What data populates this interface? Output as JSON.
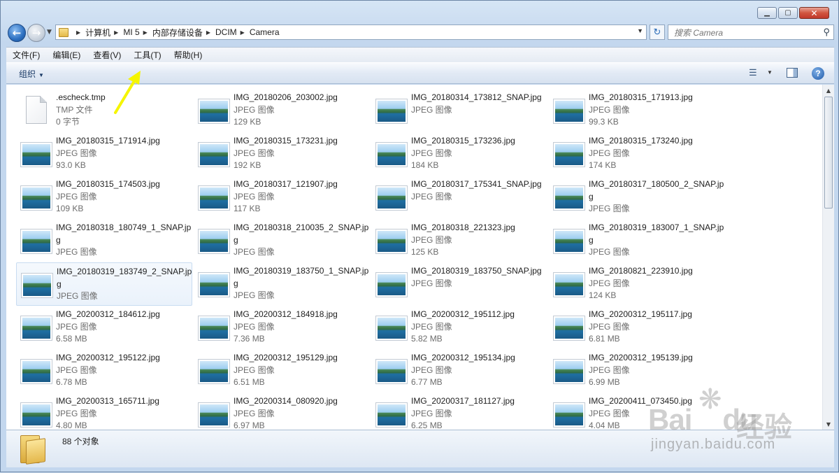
{
  "window": {
    "caption_buttons": {
      "minimize": "▁",
      "maximize": "▢",
      "close": "✕"
    }
  },
  "nav": {
    "breadcrumb": [
      "计算机",
      "MI 5",
      "内部存储设备",
      "DCIM",
      "Camera"
    ],
    "search_placeholder": "搜索 Camera"
  },
  "menu": [
    "文件(F)",
    "编辑(E)",
    "查看(V)",
    "工具(T)",
    "帮助(H)"
  ],
  "toolbar": {
    "organize_label": "组织"
  },
  "files": [
    {
      "name": ".escheck.tmp",
      "type": "TMP 文件",
      "size": "0 字节",
      "kind": "generic"
    },
    {
      "name": "IMG_20180206_203002.jpg",
      "type": "JPEG 图像",
      "size": "129 KB",
      "kind": "image"
    },
    {
      "name": "IMG_20180314_173812_SNAP.jpg",
      "type": "JPEG 图像",
      "size": "",
      "kind": "image"
    },
    {
      "name": "IMG_20180315_171913.jpg",
      "type": "JPEG 图像",
      "size": "99.3 KB",
      "kind": "image"
    },
    {
      "name": "IMG_20180315_171914.jpg",
      "type": "JPEG 图像",
      "size": "93.0 KB",
      "kind": "image"
    },
    {
      "name": "IMG_20180315_173231.jpg",
      "type": "JPEG 图像",
      "size": "192 KB",
      "kind": "image"
    },
    {
      "name": "IMG_20180315_173236.jpg",
      "type": "JPEG 图像",
      "size": "184 KB",
      "kind": "image"
    },
    {
      "name": "IMG_20180315_173240.jpg",
      "type": "JPEG 图像",
      "size": "174 KB",
      "kind": "image"
    },
    {
      "name": "IMG_20180315_174503.jpg",
      "type": "JPEG 图像",
      "size": "109 KB",
      "kind": "image"
    },
    {
      "name": "IMG_20180317_121907.jpg",
      "type": "JPEG 图像",
      "size": "117 KB",
      "kind": "image"
    },
    {
      "name": "IMG_20180317_175341_SNAP.jpg",
      "type": "JPEG 图像",
      "size": "",
      "kind": "image"
    },
    {
      "name": "IMG_20180317_180500_2_SNAP.jpg",
      "type": "JPEG 图像",
      "size": "",
      "kind": "image"
    },
    {
      "name": "IMG_20180318_180749_1_SNAP.jpg",
      "type": "JPEG 图像",
      "size": "",
      "kind": "image"
    },
    {
      "name": "IMG_20180318_210035_2_SNAP.jpg",
      "type": "JPEG 图像",
      "size": "",
      "kind": "image"
    },
    {
      "name": "IMG_20180318_221323.jpg",
      "type": "JPEG 图像",
      "size": "125 KB",
      "kind": "image"
    },
    {
      "name": "IMG_20180319_183007_1_SNAP.jpg",
      "type": "JPEG 图像",
      "size": "",
      "kind": "image"
    },
    {
      "name": "IMG_20180319_183749_2_SNAP.jpg",
      "type": "JPEG 图像",
      "size": "",
      "kind": "image",
      "selected": true
    },
    {
      "name": "IMG_20180319_183750_1_SNAP.jpg",
      "type": "JPEG 图像",
      "size": "",
      "kind": "image"
    },
    {
      "name": "IMG_20180319_183750_SNAP.jpg",
      "type": "JPEG 图像",
      "size": "",
      "kind": "image"
    },
    {
      "name": "IMG_20180821_223910.jpg",
      "type": "JPEG 图像",
      "size": "124 KB",
      "kind": "image"
    },
    {
      "name": "IMG_20200312_184612.jpg",
      "type": "JPEG 图像",
      "size": "6.58 MB",
      "kind": "image"
    },
    {
      "name": "IMG_20200312_184918.jpg",
      "type": "JPEG 图像",
      "size": "7.36 MB",
      "kind": "image"
    },
    {
      "name": "IMG_20200312_195112.jpg",
      "type": "JPEG 图像",
      "size": "5.82 MB",
      "kind": "image"
    },
    {
      "name": "IMG_20200312_195117.jpg",
      "type": "JPEG 图像",
      "size": "6.81 MB",
      "kind": "image"
    },
    {
      "name": "IMG_20200312_195122.jpg",
      "type": "JPEG 图像",
      "size": "6.78 MB",
      "kind": "image"
    },
    {
      "name": "IMG_20200312_195129.jpg",
      "type": "JPEG 图像",
      "size": "6.51 MB",
      "kind": "image"
    },
    {
      "name": "IMG_20200312_195134.jpg",
      "type": "JPEG 图像",
      "size": "6.77 MB",
      "kind": "image"
    },
    {
      "name": "IMG_20200312_195139.jpg",
      "type": "JPEG 图像",
      "size": "6.99 MB",
      "kind": "image"
    },
    {
      "name": "IMG_20200313_165711.jpg",
      "type": "JPEG 图像",
      "size": "4.80 MB",
      "kind": "image"
    },
    {
      "name": "IMG_20200314_080920.jpg",
      "type": "JPEG 图像",
      "size": "6.97 MB",
      "kind": "image"
    },
    {
      "name": "IMG_20200317_181127.jpg",
      "type": "JPEG 图像",
      "size": "6.25 MB",
      "kind": "image"
    },
    {
      "name": "IMG_20200411_073450.jpg",
      "type": "JPEG 图像",
      "size": "4.04 MB",
      "kind": "image"
    }
  ],
  "status": {
    "count": "88 个对象"
  },
  "watermark": {
    "brand": "Bai",
    "brand2": "du",
    "cn": "经验",
    "url": "jingyan.baidu.com"
  },
  "colors": {
    "accent": "#2c6fc0",
    "arrow": "#f5f500",
    "selection": "#eaf2fb"
  }
}
